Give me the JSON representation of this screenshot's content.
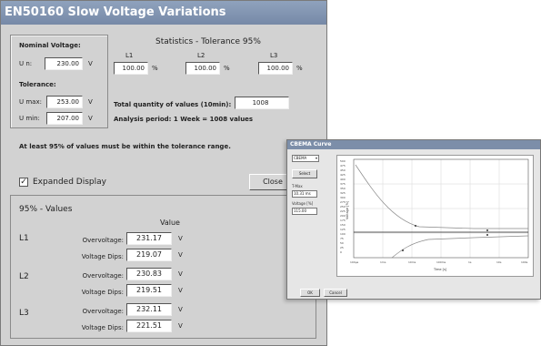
{
  "main_window": {
    "title": "EN50160 Slow Voltage Variations",
    "nominal": {
      "heading": "Nominal Voltage:",
      "un_label": "U n:",
      "un_value": "230.00",
      "unit": "V",
      "tolerance_heading": "Tolerance:",
      "umax_label": "U max:",
      "umax_value": "253.00",
      "umin_label": "U min:",
      "umin_value": "207.00"
    },
    "statistics": {
      "heading": "Statistics - Tolerance 95%",
      "phases": [
        {
          "label": "L1",
          "value": "100.00",
          "unit": "%"
        },
        {
          "label": "L2",
          "value": "100.00",
          "unit": "%"
        },
        {
          "label": "L3",
          "value": "100.00",
          "unit": "%"
        }
      ],
      "total_label": "Total quantity of values (10min):",
      "total_value": "1008",
      "period_text": "Analysis period: 1 Week = 1008 values"
    },
    "note": "At least 95% of values must be within the tolerance range.",
    "expanded_label": "Expanded Display",
    "expanded_checked": "✓",
    "close_label": "Close",
    "values_panel": {
      "heading": "95% - Values",
      "column_header": "Value",
      "overvoltage_label": "Overvoltage:",
      "dips_label": "Voltage Dips:",
      "unit": "V",
      "rows": [
        {
          "phase": "L1",
          "overvoltage": "231.17",
          "dips": "219.07"
        },
        {
          "phase": "L2",
          "overvoltage": "230.83",
          "dips": "219.51"
        },
        {
          "phase": "L3",
          "overvoltage": "232.11",
          "dips": "221.51"
        }
      ]
    }
  },
  "curve_window": {
    "title": "CBEMA Curve",
    "select_value": "CBEMA",
    "select_button": "Select",
    "field1_label": "T-Max",
    "field1_value": "10.31 ms",
    "field2_label": "Voltage [%]",
    "field2_value": "115.00",
    "ok_label": "OK",
    "cancel_label": "Cancel",
    "y_axis_label": "Voltage [%]",
    "x_axis_label": "Time [s]",
    "y_ticks": [
      "500",
      "475",
      "450",
      "425",
      "400",
      "375",
      "350",
      "325",
      "300",
      "275",
      "250",
      "225",
      "200",
      "175",
      "150",
      "125",
      "100",
      "75",
      "50",
      "25",
      "0"
    ],
    "x_ticks": [
      "100µs",
      "1ms",
      "10ms",
      "100ms",
      "1s",
      "10s",
      "100s"
    ]
  },
  "colors": {
    "title_bar": "#7c8ea9",
    "window_bg": "#d2d2d2"
  }
}
